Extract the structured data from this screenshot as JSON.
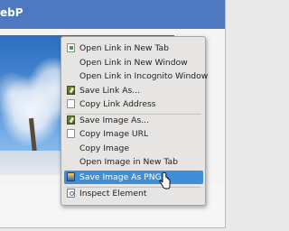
{
  "window": {
    "title_fragment": "ebP"
  },
  "context_menu": {
    "items": [
      {
        "label": "Open Link in New Tab",
        "icon": "page-green-icon"
      },
      {
        "label": "Open Link in New Window",
        "icon": ""
      },
      {
        "label": "Open Link in Incognito Window",
        "icon": ""
      },
      {
        "label": "Save Link As...",
        "icon": "save-icon"
      },
      {
        "label": "Copy Link Address",
        "icon": "page-icon"
      },
      {
        "label": "Save Image As...",
        "icon": "save-icon"
      },
      {
        "label": "Copy Image URL",
        "icon": "page-icon"
      },
      {
        "label": "Copy Image",
        "icon": ""
      },
      {
        "label": "Open Image in New Tab",
        "icon": ""
      },
      {
        "label": "Save Image As PNG",
        "icon": "png-icon",
        "highlighted": true
      },
      {
        "label": "Inspect Element",
        "icon": "inspect-icon"
      }
    ]
  },
  "colors": {
    "titlebar": "#4e79c0",
    "highlight": "#3f8ed8",
    "menu_bg": "#e7e5e3"
  }
}
